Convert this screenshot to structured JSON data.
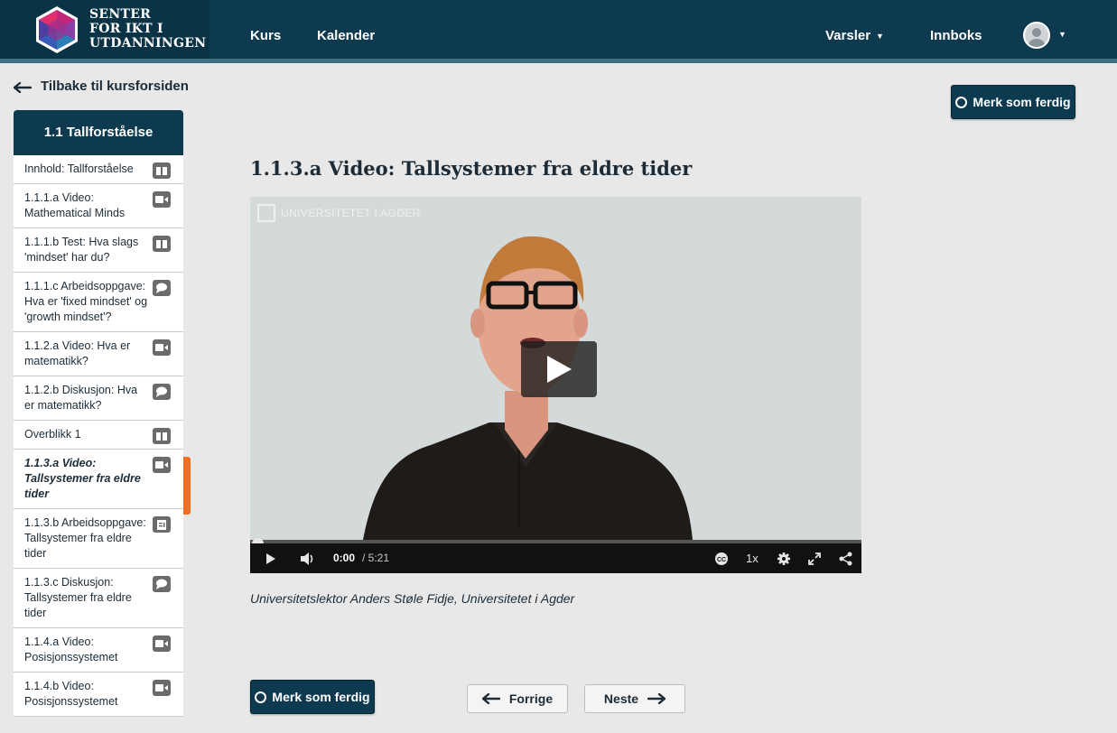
{
  "header": {
    "logo_lines": [
      "SENTER",
      "FOR IKT I",
      "UTDANNINGEN"
    ],
    "nav": {
      "courses": "Kurs",
      "calendar": "Kalender",
      "notifications": "Varsler",
      "inbox": "Innboks"
    }
  },
  "back_link": "Tilbake til kursforsiden",
  "sidebar": {
    "title": "1.1 Tallforståelse",
    "items": [
      {
        "label": "Innhold: Tallforståelse",
        "icon": "book-icon"
      },
      {
        "label": "1.1.1.a Video: Mathematical Minds",
        "icon": "video-camera-icon"
      },
      {
        "label": "1.1.1.b Test: Hva slags 'mindset' har du?",
        "icon": "book-icon"
      },
      {
        "label": "1.1.1.c Arbeidsoppgave: Hva er 'fixed mindset' og 'growth mindset'?",
        "icon": "speech-bubble-icon"
      },
      {
        "label": "1.1.2.a Video: Hva er matematikk?",
        "icon": "video-camera-icon"
      },
      {
        "label": "1.1.2.b Diskusjon: Hva er matematikk?",
        "icon": "speech-bubble-icon"
      },
      {
        "label": "Overblikk 1",
        "icon": "book-icon"
      },
      {
        "label": "1.1.3.a Video: Tallsystemer fra eldre tider",
        "icon": "video-camera-icon",
        "active": true
      },
      {
        "label": "1.1.3.b Arbeidsoppgave: Tallsystemer fra eldre tider",
        "icon": "document-icon"
      },
      {
        "label": "1.1.3.c Diskusjon: Tallsystemer fra eldre tider",
        "icon": "speech-bubble-icon"
      },
      {
        "label": "1.1.4.a Video: Posisjonssystemet",
        "icon": "video-camera-icon"
      },
      {
        "label": "1.1.4.b Video: Posisjonssystemet",
        "icon": "video-camera-icon"
      }
    ]
  },
  "main": {
    "mark_done": "Merk som ferdig",
    "title": "1.1.3.a Video: Tallsystemer fra eldre tider",
    "video": {
      "watermark": "UNIVERSITETET I AGDER",
      "time_current": "0:00",
      "time_duration": "/ 5:21",
      "speed": "1x",
      "progress": 0
    },
    "caption": "Universitetslektor Anders Støle Fidje, Universitetet i Agder"
  },
  "footer_nav": {
    "mark_done": "Merk som ferdig",
    "prev": "Forrige",
    "next": "Neste"
  },
  "colors": {
    "header": "#0e3a4f",
    "accent_active": "#f26f21",
    "background": "#e8e8e8"
  }
}
